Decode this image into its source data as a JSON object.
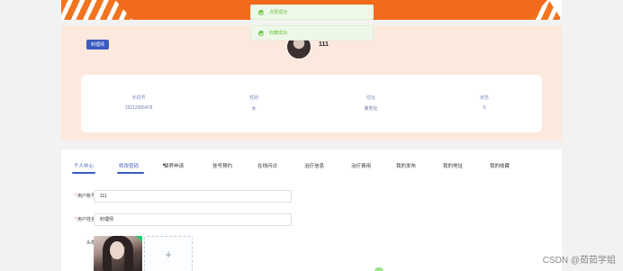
{
  "toasts": [
    {
      "text": "点赞成功"
    },
    {
      "text": "收藏成功"
    }
  ],
  "profile": {
    "role_badge": "料理师",
    "username": "111",
    "info": [
      {
        "label": "手机号",
        "value": "15212365478"
      },
      {
        "label": "性别",
        "value": "女"
      },
      {
        "label": "住址",
        "value": "某地址"
      },
      {
        "label": "状态",
        "value": "0"
      }
    ]
  },
  "tabs": [
    {
      "label": "个人中心",
      "active": true
    },
    {
      "label": "修改密码",
      "active": true
    },
    {
      "label": "领养申请"
    },
    {
      "label": "挂号预约"
    },
    {
      "label": "在线问诊"
    },
    {
      "label": "治疗信息"
    },
    {
      "label": "治疗费用"
    },
    {
      "label": "我的发布"
    },
    {
      "label": "我的地址"
    },
    {
      "label": "我的收藏"
    }
  ],
  "form": {
    "account_label": "用户帐号",
    "account_value": "111",
    "name_label": "用户姓名",
    "name_value": "料理师",
    "avatar_label": "头像",
    "upload_icon": "+"
  },
  "watermark": "CSDN @茹茹学姐",
  "colors": {
    "accent": "#3a5bbf",
    "banner": "#f26a1b",
    "profile_bg": "#fde8dd",
    "success": "#67c23a"
  }
}
